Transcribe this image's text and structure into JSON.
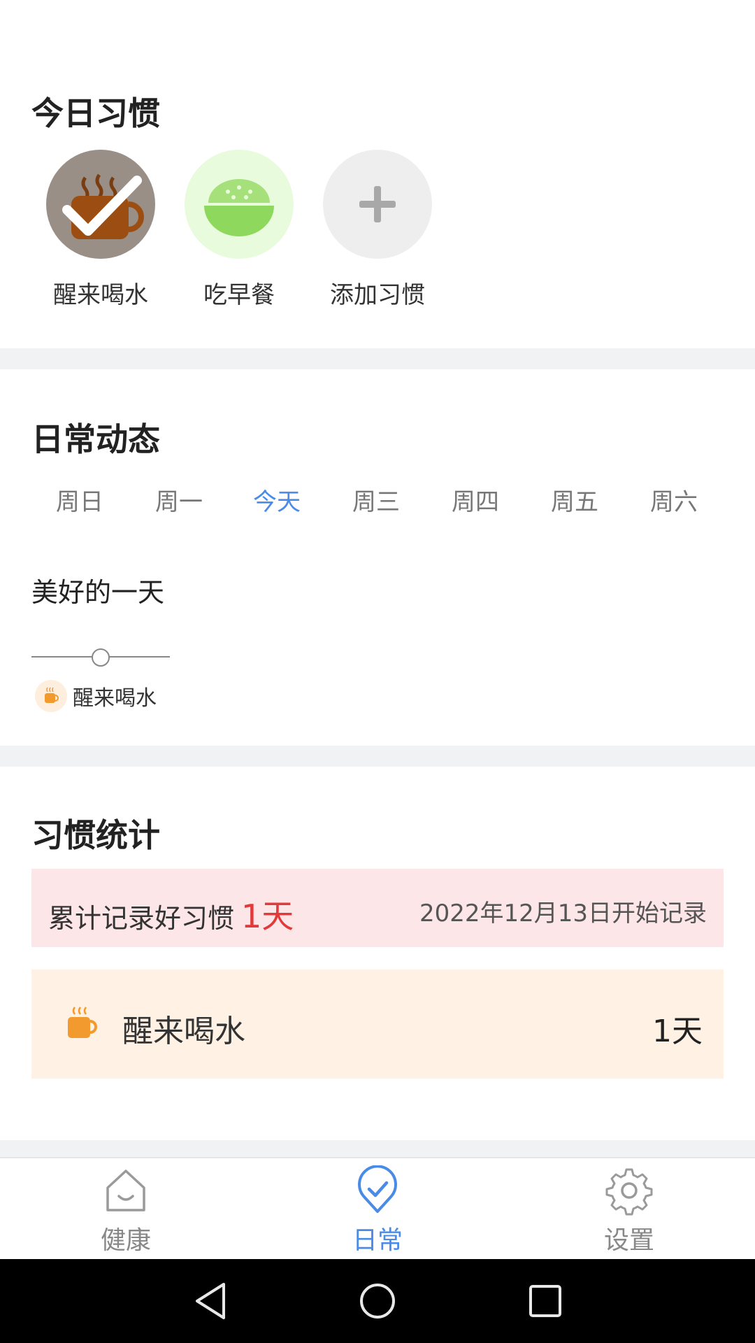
{
  "today_habits": {
    "title": "今日习惯",
    "items": [
      {
        "label": "醒来喝水",
        "icon": "coffee-cup-icon",
        "done": true
      },
      {
        "label": "吃早餐",
        "icon": "rice-bowl-icon",
        "done": false
      },
      {
        "label": "添加习惯",
        "icon": "plus-icon",
        "done": false
      }
    ]
  },
  "daily": {
    "title": "日常动态",
    "tabs": [
      "周日",
      "周一",
      "今天",
      "周三",
      "周四",
      "周五",
      "周六"
    ],
    "active_tab": "今天",
    "day_title": "美好的一天",
    "timeline": [
      {
        "label": "醒来喝水",
        "icon": "coffee-cup-icon"
      }
    ]
  },
  "stats": {
    "title": "习惯统计",
    "total_label": "累计记录好习惯",
    "total_value": "1天",
    "start_text": "2022年12月13日开始记录",
    "rows": [
      {
        "name": "醒来喝水",
        "days": "1天",
        "icon": "coffee-cup-icon"
      }
    ]
  },
  "nav": {
    "items": [
      {
        "label": "健康",
        "icon": "house-smile-icon"
      },
      {
        "label": "日常",
        "icon": "check-badge-icon"
      },
      {
        "label": "设置",
        "icon": "gear-icon"
      }
    ],
    "active": "日常"
  },
  "colors": {
    "accent": "#4a8be8",
    "highlight_red": "#e23a3a",
    "total_bg": "#fde6e8",
    "row_bg": "#fff2e4"
  }
}
